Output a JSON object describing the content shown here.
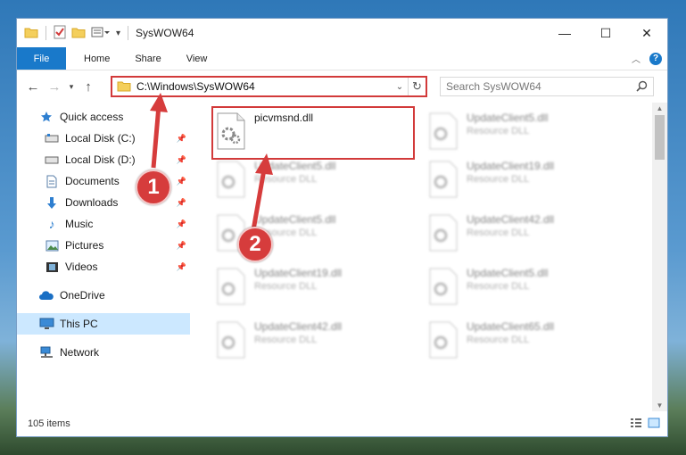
{
  "window": {
    "title": "SysWOW64",
    "controls": {
      "minimize": "—",
      "maximize": "☐",
      "close": "✕"
    }
  },
  "ribbon": {
    "tabs": [
      {
        "label": "File",
        "active": true
      },
      {
        "label": "Home"
      },
      {
        "label": "Share"
      },
      {
        "label": "View"
      }
    ],
    "accent": "#1979ca"
  },
  "address": {
    "path": "C:\\Windows\\SysWOW64",
    "search_placeholder": "Search SysWOW64"
  },
  "nav": {
    "items": [
      {
        "label": "Quick access",
        "icon": "star-icon",
        "pinned": false
      },
      {
        "label": "Local Disk (C:)",
        "icon": "drive-icon",
        "pinned": true
      },
      {
        "label": "Local Disk (D:)",
        "icon": "drive-icon",
        "pinned": true
      },
      {
        "label": "Documents",
        "icon": "documents-icon",
        "pinned": true
      },
      {
        "label": "Downloads",
        "icon": "downloads-icon",
        "pinned": true
      },
      {
        "label": "Music",
        "icon": "music-icon",
        "pinned": true
      },
      {
        "label": "Pictures",
        "icon": "pictures-icon",
        "pinned": true
      },
      {
        "label": "Videos",
        "icon": "videos-icon",
        "pinned": true
      },
      {
        "label": "OneDrive",
        "icon": "onedrive-icon",
        "pinned": false
      },
      {
        "label": "This PC",
        "icon": "pc-icon",
        "pinned": false,
        "selected": true
      },
      {
        "label": "Network",
        "icon": "network-icon",
        "pinned": false
      }
    ]
  },
  "files": {
    "left": [
      {
        "name": "picvmsnd.dll",
        "type": ""
      },
      {
        "name": "UpdateClient5.dll",
        "type": "Resource DLL"
      },
      {
        "name": "UpdateClient5.dll",
        "type": "Resource DLL"
      },
      {
        "name": "UpdateClient19.dll",
        "type": "Resource DLL"
      },
      {
        "name": "UpdateClient42.dll",
        "type": "Resource DLL"
      }
    ],
    "right": [
      {
        "name": "UpdateClient5.dll",
        "type": "Resource DLL"
      },
      {
        "name": "UpdateClient19.dll",
        "type": "Resource DLL"
      },
      {
        "name": "UpdateClient42.dll",
        "type": "Resource DLL"
      },
      {
        "name": "UpdateClient5.dll",
        "type": "Resource DLL"
      },
      {
        "name": "UpdateClient65.dll",
        "type": "Resource DLL"
      }
    ]
  },
  "status": {
    "item_count": "105 items"
  },
  "annotations": {
    "step1": "1",
    "step2": "2",
    "color": "#d63c3c"
  }
}
